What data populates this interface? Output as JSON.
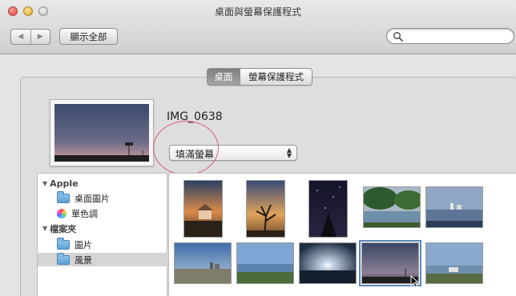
{
  "window": {
    "title": "桌面與螢幕保護程式"
  },
  "toolbar": {
    "show_all_label": "顯示全部",
    "back_icon": "triangle-left",
    "forward_icon": "triangle-right",
    "search_placeholder": ""
  },
  "tabs": [
    {
      "label": "桌面",
      "active": true
    },
    {
      "label": "螢幕保護程式",
      "active": false
    }
  ],
  "current": {
    "filename": "IMG_0638",
    "fill_mode": "填滿螢幕"
  },
  "source_list": {
    "apple_group": "Apple",
    "apple_items": [
      {
        "label": "桌面圖片",
        "icon": "folder-icon"
      },
      {
        "label": "單色調",
        "icon": "color-wheel-icon"
      }
    ],
    "folders_group": "檔案夾",
    "folder_items": [
      {
        "label": "圖片",
        "icon": "folder-icon",
        "selected": false
      },
      {
        "label": "風景",
        "icon": "folder-icon",
        "selected": true
      }
    ]
  },
  "thumbnails": [
    {
      "name": "sunset-house"
    },
    {
      "name": "tree-silhouette"
    },
    {
      "name": "starry-sky"
    },
    {
      "name": "river-trees"
    },
    {
      "name": "harbor-city"
    },
    {
      "name": "city-skyline"
    },
    {
      "name": "lakeside"
    },
    {
      "name": "moon-horizon"
    },
    {
      "name": "dusk-field",
      "selected": true
    },
    {
      "name": "shore-pavilion"
    }
  ],
  "colors": {
    "selection_ring": "#5b87b8",
    "annotation_circle": "#d75a78"
  }
}
